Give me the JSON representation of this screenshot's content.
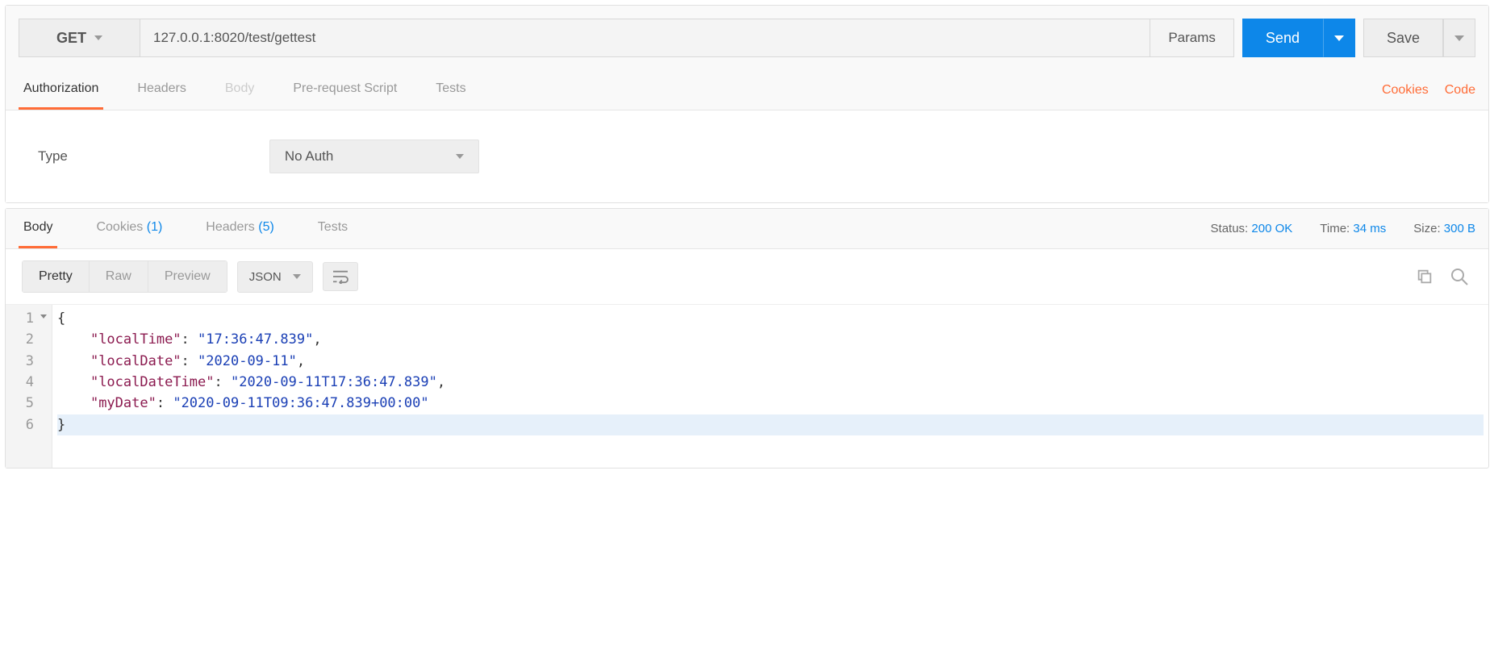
{
  "request": {
    "method": "GET",
    "url": "127.0.0.1:8020/test/gettest",
    "params_label": "Params",
    "send_label": "Send",
    "save_label": "Save"
  },
  "request_tabs": {
    "authorization": "Authorization",
    "headers": "Headers",
    "body": "Body",
    "prerequest": "Pre-request Script",
    "tests": "Tests",
    "cookies_link": "Cookies",
    "code_link": "Code"
  },
  "auth": {
    "type_label": "Type",
    "selected": "No Auth"
  },
  "response_tabs": {
    "body": "Body",
    "cookies_label": "Cookies",
    "cookies_count": "(1)",
    "headers_label": "Headers",
    "headers_count": "(5)",
    "tests": "Tests"
  },
  "meta": {
    "status_label": "Status:",
    "status_value": "200 OK",
    "time_label": "Time:",
    "time_value": "34 ms",
    "size_label": "Size:",
    "size_value": "300 B"
  },
  "viewer": {
    "pretty": "Pretty",
    "raw": "Raw",
    "preview": "Preview",
    "format": "JSON"
  },
  "code_lines": [
    {
      "n": 1,
      "fold": true,
      "text": "{"
    },
    {
      "n": 2,
      "key": "localTime",
      "value": "17:36:47.839",
      "comma": true
    },
    {
      "n": 3,
      "key": "localDate",
      "value": "2020-09-11",
      "comma": true
    },
    {
      "n": 4,
      "key": "localDateTime",
      "value": "2020-09-11T17:36:47.839",
      "comma": true
    },
    {
      "n": 5,
      "key": "myDate",
      "value": "2020-09-11T09:36:47.839+00:00",
      "comma": false
    },
    {
      "n": 6,
      "text": "}",
      "hl": true
    }
  ]
}
